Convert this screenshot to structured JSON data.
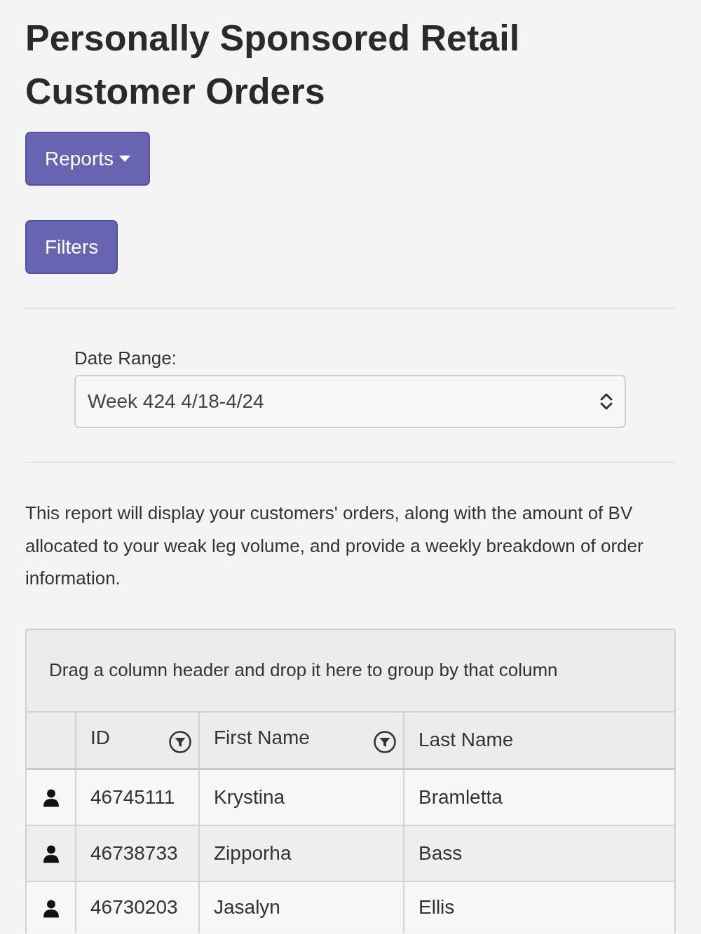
{
  "page": {
    "title": "Personally Sponsored Retail Customer Orders"
  },
  "reports_button": {
    "label": "Reports"
  },
  "filters_button": {
    "label": "Filters"
  },
  "date_range": {
    "label": "Date Range:",
    "value": "Week 424 4/18-4/24"
  },
  "description": "This report will display your customers' orders, along with the amount of BV allocated to your weak leg volume, and provide a weekly breakdown of order information.",
  "grid": {
    "group_panel": "Drag a column header and drop it here to group by that column",
    "columns": [
      {
        "label": "ID",
        "filter": true
      },
      {
        "label": "First Name",
        "filter": true
      },
      {
        "label": "Last Name",
        "filter": false
      }
    ],
    "rows": [
      {
        "id": "46745111",
        "first_name": "Krystina",
        "last_name": "Bramletta"
      },
      {
        "id": "46738733",
        "first_name": "Zipporha",
        "last_name": "Bass"
      },
      {
        "id": "46730203",
        "first_name": "Jasalyn",
        "last_name": "Ellis"
      }
    ]
  }
}
